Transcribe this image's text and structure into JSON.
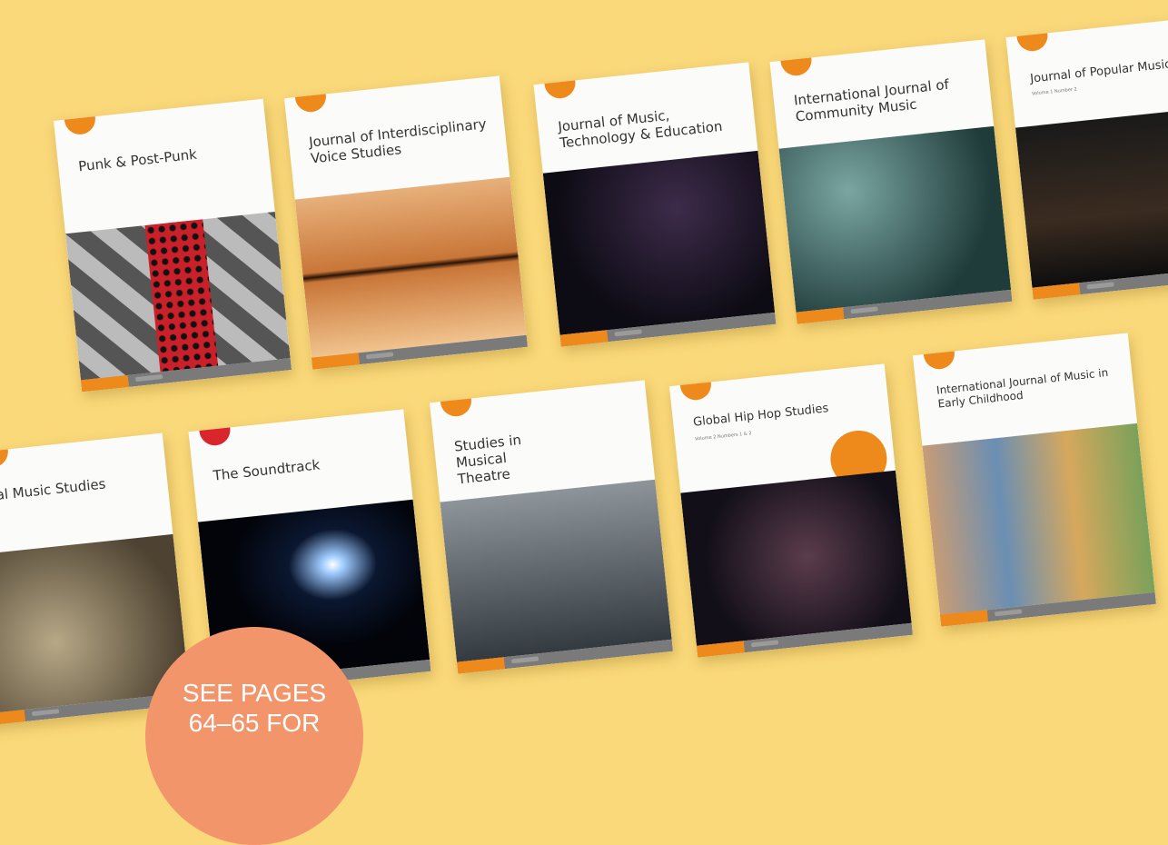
{
  "covers": [
    {
      "title": "Punk & Post-Punk"
    },
    {
      "title": "Journal of Interdisciplinary Voice Studies"
    },
    {
      "title": "Journal of Music, Technology & Education"
    },
    {
      "title": "International Journal of Community Music"
    },
    {
      "title": "Journal of Popular Music Edu",
      "subtitle": "Volume 1 Number 2"
    },
    {
      "title": "tal Music Studies"
    },
    {
      "title": "The Soundtrack"
    },
    {
      "title": "Studies in Musical Theatre"
    },
    {
      "title": "Global Hip Hop Studies",
      "subtitle": "Volume 2 Numbers 1 & 2"
    },
    {
      "title": "International Journal of Music in Early Childhood"
    }
  ],
  "promo": {
    "line1": "SEE PAGES",
    "line2": "64–65 FOR"
  },
  "colors": {
    "background": "#fad97a",
    "accent": "#ee8a1b",
    "promo": "#f3956b",
    "footer": "#7a7a7a"
  }
}
